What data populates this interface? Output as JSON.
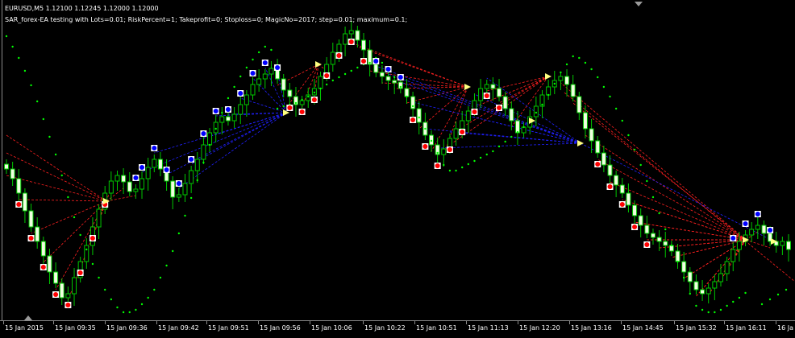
{
  "header": {
    "symbol_line": "EURUSD,M5  1.12100 1.12245 1.12000 1.12000",
    "ea_line": "SAR_forex-EA testing with Lots=0.01; RiskPercent=1; Takeprofit=0; Stoploss=0; MagicNo=2017; step=0.01; maximum=0.1;"
  },
  "colors": {
    "background": "#000000",
    "bull_body": "#000000",
    "bear_body": "#f0ffe0",
    "candle_outline": "#00c800",
    "sar_dots": "#00ff00",
    "buy_arrow": "#0000ff",
    "sell_arrow": "#ff0000",
    "buy_lines": "#2020ff",
    "sell_lines": "#ff2020"
  },
  "time_axis": {
    "labels": [
      "15 Jan 2015",
      "15 Jan 09:35",
      "15 Jan 09:36",
      "15 Jan 09:42",
      "15 Jan 09:51",
      "15 Jan 09:56",
      "15 Jan 10:06",
      "15 Jan 10:22",
      "15 Jan 10:51",
      "15 Jan 11:13",
      "15 Jan 12:20",
      "15 Jan 13:16",
      "15 Jan 14:45",
      "15 Jan 15:32",
      "15 Jan 16:11",
      "16 Ja"
    ]
  },
  "chart_data": {
    "type": "candlestick",
    "symbol": "EURUSD",
    "timeframe": "M5",
    "ohlc_last": {
      "open": 1.121,
      "high": 1.12245,
      "low": 1.12,
      "close": 1.12
    },
    "x_labels": [
      "15 Jan 2015",
      "15 Jan 09:35",
      "15 Jan 09:36",
      "15 Jan 09:42",
      "15 Jan 09:51",
      "15 Jan 09:56",
      "15 Jan 10:06",
      "15 Jan 10:22",
      "15 Jan 10:51",
      "15 Jan 11:13",
      "15 Jan 12:20",
      "15 Jan 13:16",
      "15 Jan 14:45",
      "15 Jan 15:32",
      "15 Jan 16:11",
      "16 Ja"
    ],
    "series": [
      {
        "type": "close_path",
        "values": [
          210,
          222,
          240,
          262,
          282,
          300,
          318,
          338,
          352,
          370,
          365,
          345,
          325,
          305,
          282,
          260,
          240,
          225,
          218,
          226,
          238,
          235,
          222,
          208,
          198,
          210,
          225,
          245,
          242,
          228,
          212,
          198,
          180,
          165,
          152,
          145,
          150,
          142,
          130,
          118,
          105,
          98,
          92,
          85,
          98,
          112,
          120,
          130,
          125,
          118,
          110,
          95,
          80,
          65,
          55,
          42,
          38,
          50,
          62,
          80,
          90,
          95,
          100,
          102,
          110,
          120,
          135,
          152,
          168,
          180,
          192,
          185,
          172,
          160,
          150,
          138,
          125,
          110,
          105,
          110,
          120,
          135,
          150,
          165,
          158,
          145,
          132,
          118,
          108,
          100,
          95,
          105,
          120,
          140,
          160,
          175,
          190,
          205,
          218,
          230,
          240,
          255,
          268,
          280,
          290,
          295,
          300,
          305,
          312,
          325,
          338,
          350,
          360,
          365,
          358,
          350,
          340,
          325,
          310,
          300,
          292,
          285,
          280,
          290,
          300,
          305,
          300,
          310
        ]
      },
      {
        "type": "parabolic_sar",
        "values": [
          45,
          58,
          72,
          88,
          106,
          126,
          148,
          170,
          192,
          218,
          245,
          270,
          292,
          310,
          328,
          345,
          360,
          372,
          382,
          388,
          388,
          385,
          378,
          370,
          360,
          345,
          330,
          312,
          290,
          268,
          246,
          224,
          202,
          180,
          160,
          140,
          122,
          108,
          95,
          84,
          74,
          65,
          58,
          62,
          135,
          132,
          130,
          128,
          124,
          120,
          115,
          110,
          105,
          100,
          96,
          92,
          88,
          84,
          80,
          78,
          72,
          78,
          86,
          96,
          108,
          120,
          132,
          146,
          160,
          175,
          190,
          205,
          212,
          212,
          208,
          204,
          200,
          196,
          192,
          188,
          182,
          176,
          170,
          164,
          158,
          150,
          140,
          130,
          118,
          104,
          90,
          80,
          70,
          72,
          78,
          86,
          96,
          108,
          120,
          135,
          150,
          168,
          186,
          205,
          225,
          245,
          265,
          285,
          305,
          325,
          345,
          365,
          380,
          385,
          388,
          388,
          385,
          380,
          375,
          370,
          364
        ]
      },
      {
        "type": "buy_signals",
        "count": 20
      },
      {
        "type": "sell_signals",
        "count": 28
      }
    ]
  }
}
